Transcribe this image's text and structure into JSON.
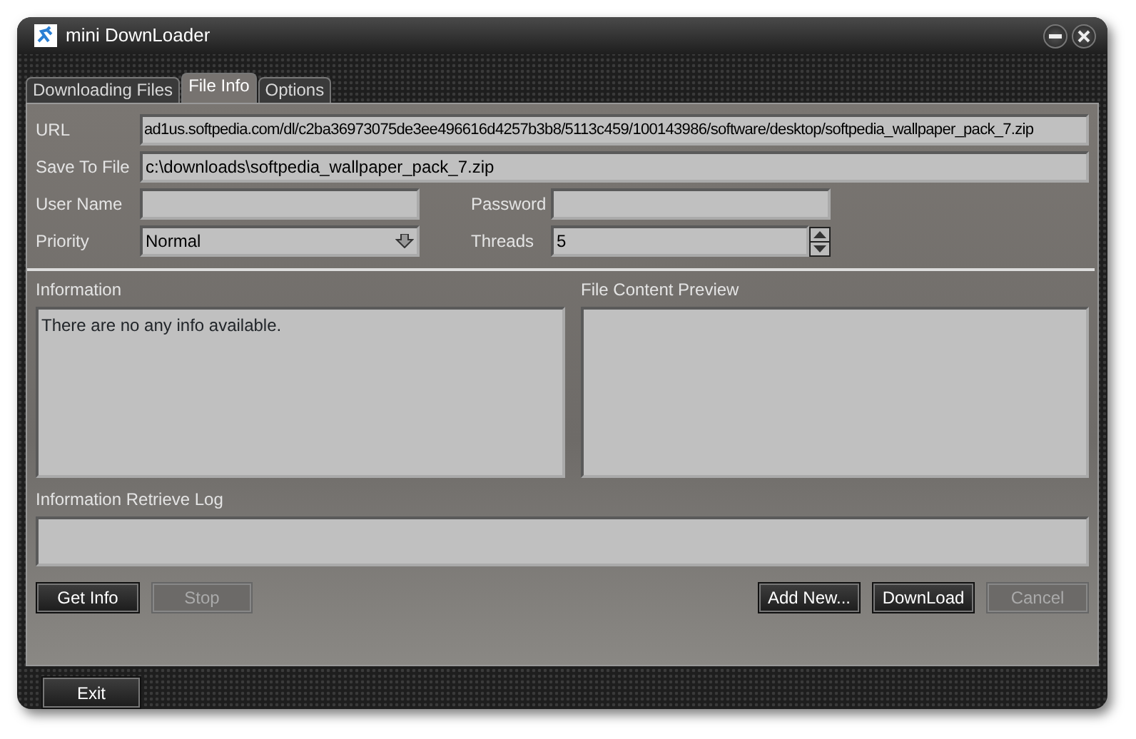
{
  "window": {
    "title": "mini DownLoader"
  },
  "tabs": [
    {
      "label": "Downloading Files",
      "selected": false
    },
    {
      "label": "File Info",
      "selected": true
    },
    {
      "label": "Options",
      "selected": false
    }
  ],
  "form": {
    "url": {
      "label": "URL",
      "value": "ad1us.softpedia.com/dl/c2ba36973075de3ee496616d4257b3b8/5113c459/100143986/software/desktop/softpedia_wallpaper_pack_7.zip"
    },
    "save_to_file": {
      "label": "Save To File",
      "value": "c:\\downloads\\softpedia_wallpaper_pack_7.zip"
    },
    "user_name": {
      "label": "User Name"
    },
    "password": {
      "label": "Password"
    },
    "priority": {
      "label": "Priority",
      "value": "Normal"
    },
    "threads": {
      "label": "Threads",
      "value": "5"
    }
  },
  "information": {
    "label": "Information",
    "text": "There are no any info available."
  },
  "file_content_preview": {
    "label": "File Content Preview"
  },
  "information_retrieve_log": {
    "label": "Information Retrieve Log"
  },
  "left_buttons": [
    {
      "label": "Get Info",
      "disabled": false
    },
    {
      "label": "Stop",
      "disabled": true
    }
  ],
  "right_buttons": [
    {
      "label": "Add New...",
      "disabled": false
    },
    {
      "label": "DownLoad",
      "disabled": false
    },
    {
      "label": "Cancel",
      "disabled": true
    }
  ],
  "footer_button": {
    "label": "Exit",
    "disabled": false
  }
}
